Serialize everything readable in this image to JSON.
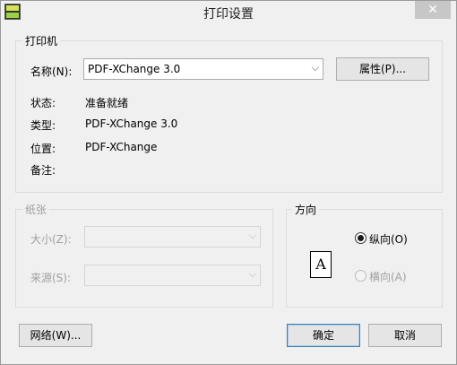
{
  "window": {
    "title": "打印设置",
    "close_glyph": "✕"
  },
  "printer": {
    "group_title": "打印机",
    "name_label": "名称(N):",
    "name_value": "PDF-XChange 3.0",
    "properties_button": "属性(P)...",
    "status_label": "状态:",
    "status_value": "准备就绪",
    "type_label": "类型:",
    "type_value": "PDF-XChange 3.0",
    "location_label": "位置:",
    "location_value": "PDF-XChange",
    "comment_label": "备注:",
    "comment_value": ""
  },
  "paper": {
    "group_title": "纸张",
    "size_label": "大小(Z):",
    "size_value": "",
    "source_label": "来源(S):",
    "source_value": ""
  },
  "orientation": {
    "group_title": "方向",
    "portrait_label": "纵向(O)",
    "landscape_label": "横向(A)",
    "selected": "portrait",
    "page_glyph": "A"
  },
  "buttons": {
    "network": "网络(W)...",
    "ok": "确定",
    "cancel": "取消"
  },
  "icons": {
    "dropdown": "chevron-down-icon",
    "app": "pdf-xchange-app-icon"
  }
}
